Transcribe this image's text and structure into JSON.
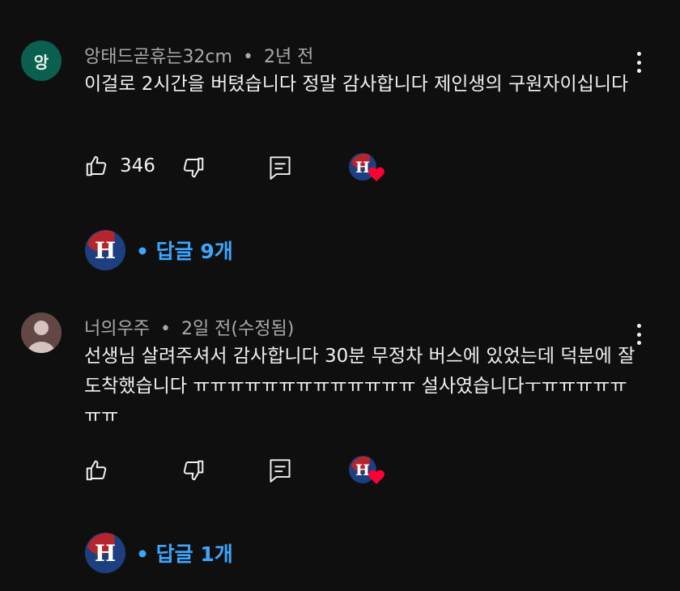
{
  "comments": [
    {
      "avatar_letter": "앙",
      "author": "앙태드곧휴는32cm",
      "separator": "•",
      "time": "2년 전",
      "text": "이걸로 2시간을 버텼습니다 정말 감사합니다 제인생의 구원자이십니다",
      "likes": "346",
      "replies_label": "• 답글 9개"
    },
    {
      "author": "너의우주",
      "separator": "•",
      "time": "2일 전(수정됨)",
      "text": "선생님 살려주셔서 감사합니다 30분 무정차 버스에 있었는데 덕분에 잘 도착했습니다 ㅠㅠㅠㅠㅠㅠㅠㅠㅠㅠㅠㅠㅠ 설사였습니다ㅜㅠㅠㅠㅠㅠㅠㅠ",
      "likes": "",
      "replies_label": "• 답글 1개"
    }
  ],
  "icons": {
    "like": "thumbs-up-icon",
    "dislike": "thumbs-down-icon",
    "reply": "reply-icon",
    "more": "more-vertical-icon",
    "creator_heart": "creator-heart-icon"
  },
  "colors": {
    "background": "#0f0f0f",
    "text": "#f1f1f1",
    "secondary_text": "#aaaaaa",
    "link": "#3ea6ff",
    "heart": "#ff0033",
    "avatar_green": "#0b5f4e",
    "channel_red": "#b3262e",
    "channel_blue": "#1d3f7f"
  }
}
